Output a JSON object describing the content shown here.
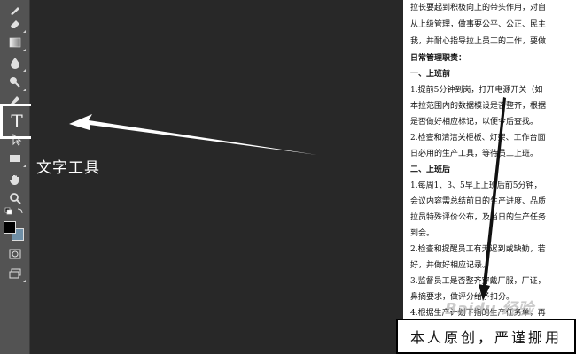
{
  "toolbar": {
    "tools": [
      {
        "name": "brush-tool",
        "icon": "brush-icon"
      },
      {
        "name": "eraser-tool",
        "icon": "eraser-icon"
      },
      {
        "name": "gradient-tool",
        "icon": "gradient-icon"
      },
      {
        "name": "blur-tool",
        "icon": "droplet-icon"
      },
      {
        "name": "dodge-tool",
        "icon": "dodge-icon"
      },
      {
        "name": "pen-tool",
        "icon": "pen-icon"
      },
      {
        "name": "type-tool",
        "icon": "type-icon",
        "glyph": "T",
        "selected": true
      },
      {
        "name": "path-selection-tool",
        "icon": "arrow-cursor-icon"
      },
      {
        "name": "rectangle-tool",
        "icon": "rectangle-icon"
      },
      {
        "name": "hand-tool",
        "icon": "hand-icon"
      },
      {
        "name": "zoom-tool",
        "icon": "magnifier-icon"
      },
      {
        "name": "quick-mask-tool",
        "icon": "quick-mask-icon"
      },
      {
        "name": "screen-mode-tool",
        "icon": "screen-mode-icon"
      }
    ],
    "foreground_color": "#000000",
    "background_color": "#6f8fa6"
  },
  "annotation": {
    "label": "文字工具",
    "highlight_color": "#ffffff"
  },
  "document": {
    "lines": [
      {
        "text": "拉长要起到积极向上的带头作用，对自",
        "bold": false
      },
      {
        "text": "从上级管理，做事要公平、公正、民主",
        "bold": false
      },
      {
        "text": "我，并耐心指导拉上员工的工作，要做",
        "bold": false
      },
      {
        "text": "日常管理职责：",
        "bold": true
      },
      {
        "text": "一、上班前",
        "bold": true
      },
      {
        "text": "1.提前5分钟到岗，打开电源开关（如",
        "bold": false
      },
      {
        "text": "本拉范围内的数据模设是否整齐，根据",
        "bold": false
      },
      {
        "text": "是否做好相应标记，以便今后查找。",
        "bold": false
      },
      {
        "text": "2.检查和清洁关柜板、灯架、工作台面",
        "bold": false
      },
      {
        "text": "日必用的生产工具，等待员工上班。",
        "bold": false
      },
      {
        "text": "二、上班后",
        "bold": true
      },
      {
        "text": "1.每周1、3、5早上上班后前5分钟，",
        "bold": false
      },
      {
        "text": "会议内容需总结前日的生产进度、品质",
        "bold": false
      },
      {
        "text": "拉员特殊评价公布，及当日的生产任务",
        "bold": false
      },
      {
        "text": "到会。",
        "bold": false
      },
      {
        "text": "2.检查和提醒员工有无迟到或缺勤，若",
        "bold": false
      },
      {
        "text": "好，并做好相应记录。",
        "bold": false
      },
      {
        "text": "3.监督员工是否整齐穿戴厂服，厂证，",
        "bold": false
      },
      {
        "text": "鼻摘要求，做评分给予扣分。",
        "bold": false
      },
      {
        "text": "4.根据生产计划下指的生产任务单，再",
        "bold": false
      }
    ],
    "watermark": "Baidu 经验"
  },
  "notice": {
    "text": "本人原创，严谨挪用"
  },
  "colors": {
    "workspace": "#282828",
    "toolbar": "#535353",
    "page": "#ffffff",
    "arrow": "#ffffff",
    "notice_arrow": "#111111"
  }
}
